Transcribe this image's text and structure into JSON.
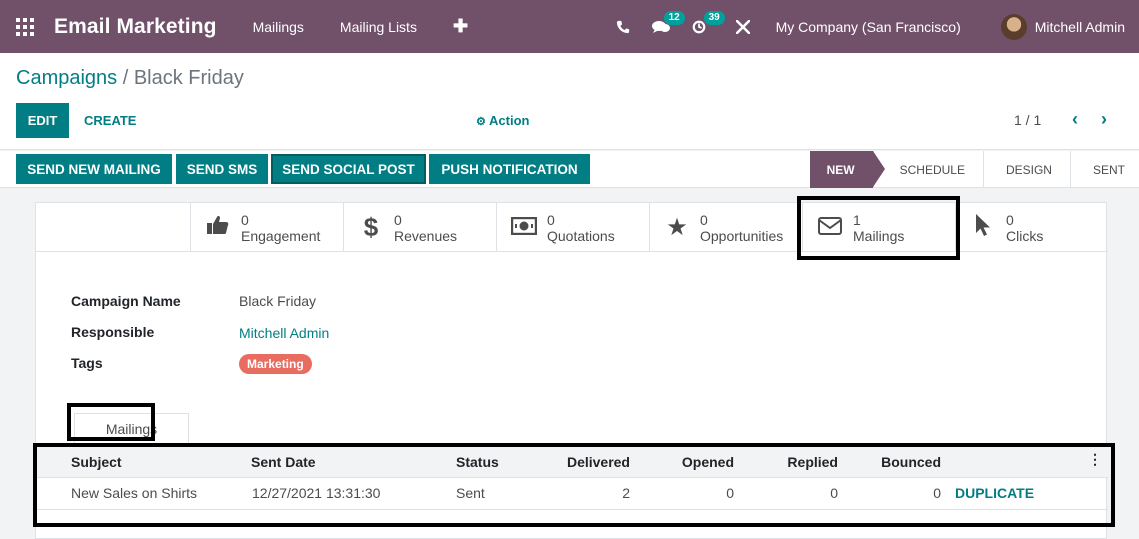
{
  "topnav": {
    "brand": "Email Marketing",
    "menu": [
      "Mailings",
      "Mailing Lists"
    ],
    "plus_label": "✚",
    "chat_badge": "12",
    "activity_badge": "39",
    "company": "My Company (San Francisco)",
    "user": "Mitchell Admin"
  },
  "breadcrumb": {
    "parent": "Campaigns",
    "separator": " / ",
    "current": "Black Friday"
  },
  "toolbar": {
    "edit": "EDIT",
    "create": "CREATE",
    "action": "Action",
    "pager": "1 / 1"
  },
  "header_buttons": [
    "SEND NEW MAILING",
    "SEND SMS",
    "SEND SOCIAL POST",
    "PUSH NOTIFICATION"
  ],
  "stages": [
    "NEW",
    "SCHEDULE",
    "DESIGN",
    "SENT"
  ],
  "stat_buttons": [
    {
      "value": "0",
      "label": "Engagement",
      "icon": "thumbs-up-icon"
    },
    {
      "value": "0",
      "label": "Revenues",
      "icon": "dollar-icon"
    },
    {
      "value": "0",
      "label": "Quotations",
      "icon": "money-bill-icon"
    },
    {
      "value": "0",
      "label": "Opportunities",
      "icon": "star-icon"
    },
    {
      "value": "1",
      "label": "Mailings",
      "icon": "envelope-icon"
    },
    {
      "value": "0",
      "label": "Clicks",
      "icon": "pointer-icon"
    }
  ],
  "form": {
    "campaign_name_label": "Campaign Name",
    "campaign_name": "Black Friday",
    "responsible_label": "Responsible",
    "responsible": "Mitchell Admin",
    "tags_label": "Tags",
    "tag": "Marketing",
    "tab": "Mailings"
  },
  "mailings_table": {
    "columns": [
      "Subject",
      "Sent Date",
      "Status",
      "Delivered",
      "Opened",
      "Replied",
      "Bounced"
    ],
    "rows": [
      {
        "subject": "New Sales on Shirts",
        "sent_date": "12/27/2021 13:31:30",
        "status": "Sent",
        "delivered": "2",
        "opened": "0",
        "replied": "0",
        "bounced": "0",
        "action": "DUPLICATE"
      }
    ]
  },
  "colors": {
    "brand": "#71506a",
    "primary": "#017e84",
    "tag": "#e86c5f",
    "badge": "#00a09d"
  }
}
